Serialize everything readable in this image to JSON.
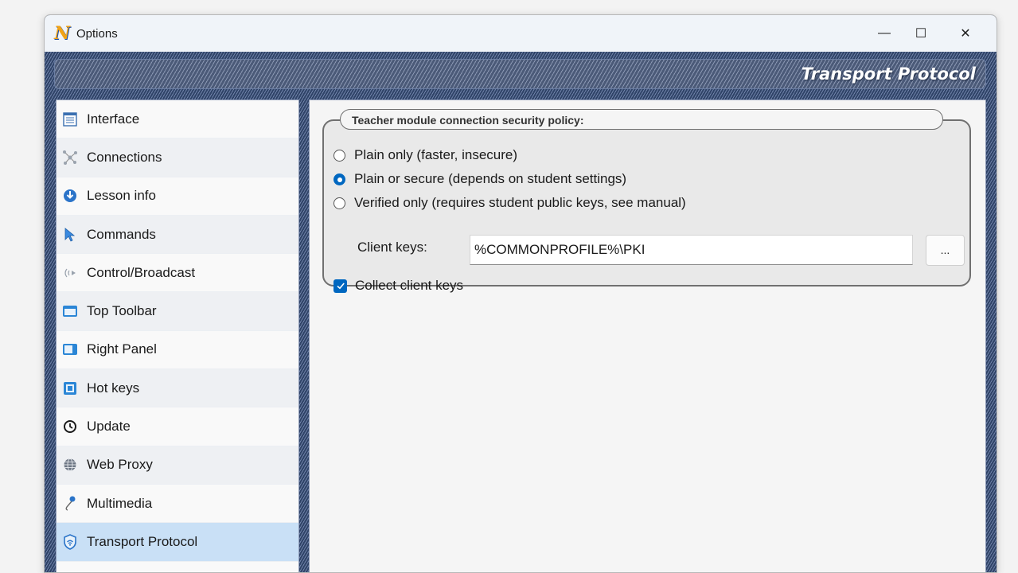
{
  "window": {
    "title": "Options",
    "controls": {
      "minimize": "—",
      "maximize": "☐",
      "close": "✕"
    }
  },
  "banner": {
    "title": "Transport Protocol"
  },
  "sidebar": {
    "items": [
      {
        "label": "Interface",
        "icon": "interface-icon"
      },
      {
        "label": "Connections",
        "icon": "connections-icon"
      },
      {
        "label": "Lesson info",
        "icon": "lesson-info-icon"
      },
      {
        "label": "Commands",
        "icon": "commands-icon"
      },
      {
        "label": "Control/Broadcast",
        "icon": "broadcast-icon"
      },
      {
        "label": "Top Toolbar",
        "icon": "top-toolbar-icon"
      },
      {
        "label": "Right Panel",
        "icon": "right-panel-icon"
      },
      {
        "label": "Hot keys",
        "icon": "hot-keys-icon"
      },
      {
        "label": "Update",
        "icon": "update-icon"
      },
      {
        "label": "Web Proxy",
        "icon": "web-proxy-icon"
      },
      {
        "label": "Multimedia",
        "icon": "multimedia-icon"
      },
      {
        "label": "Transport Protocol",
        "icon": "shield-icon",
        "selected": true
      }
    ]
  },
  "policy": {
    "legend": "Teacher module connection security policy:",
    "options": [
      {
        "label": "Plain only (faster, insecure)",
        "checked": false
      },
      {
        "label": "Plain or secure (depends on student settings)",
        "checked": true
      },
      {
        "label": "Verified only (requires student public keys, see manual)",
        "checked": false
      }
    ],
    "client_keys_label": "Client keys:",
    "client_keys_value": "%COMMONPROFILE%\\PKI",
    "browse_label": "...",
    "collect_label": "Collect client keys",
    "collect_checked": true
  },
  "colors": {
    "accent": "#0067c0",
    "selected_item": "#c9e0f6",
    "frame": "#33486e"
  }
}
